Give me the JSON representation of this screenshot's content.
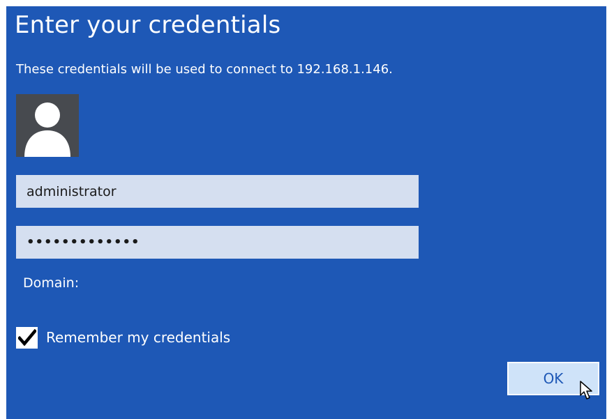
{
  "dialog": {
    "title": "Enter your credentials",
    "subtitle": "These credentials will be used to connect to 192.168.1.146.",
    "avatar_icon": "user-silhouette-icon",
    "username_value": "administrator",
    "password_mask": "•••••••••••••",
    "domain_label": "Domain:",
    "remember": {
      "label": "Remember my credentials",
      "checked": true
    },
    "ok_label": "OK"
  },
  "colors": {
    "dialog_background": "#1e58b6",
    "field_background": "#d5dff0",
    "avatar_background": "#474a4f",
    "button_background": "#cfe3f9",
    "text": "#ffffff"
  }
}
